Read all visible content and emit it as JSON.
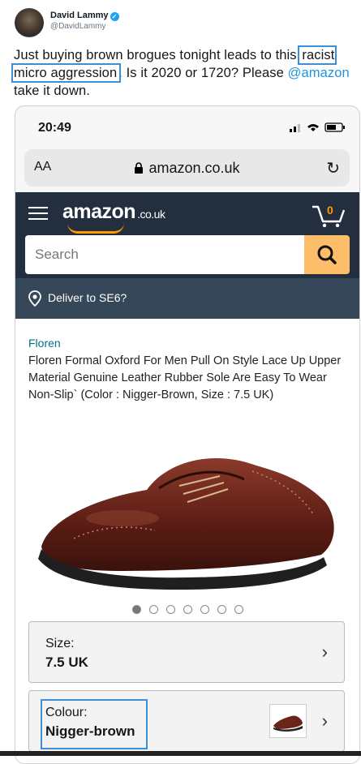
{
  "tweet": {
    "author_name": "David Lammy",
    "author_handle": "@DavidLammy",
    "text_part1": "Just buying brown brogues tonight leads to this",
    "text_highlight": "racist micro aggression",
    "text_part2": ". Is it 2020 or 1720? Please",
    "mention": "@amazon",
    "text_part3": " take it down."
  },
  "phone": {
    "time": "20:49",
    "text_size_label": "AA",
    "url": "amazon.co.uk",
    "search_placeholder": "Search",
    "logo_text": "amazon",
    "logo_suffix": ".co.uk",
    "cart_count": "0",
    "deliver_text": "Deliver to SE6?"
  },
  "product": {
    "brand": "Floren",
    "title": "Floren Formal Oxford For Men Pull On Style Lace Up Upper Material Genuine Leather Rubber Sole Are Easy To Wear Non-Slip` (Color : Nigger-Brown, Size : 7.5 UK)",
    "image_count": 7,
    "active_image_index": 1,
    "size_label": "Size:",
    "size_value": "7.5 UK",
    "colour_label": "Colour:",
    "colour_value": "Nigger-brown"
  },
  "colors": {
    "amazon_navy": "#232f3e",
    "amazon_orange": "#ff9900",
    "search_button": "#febd69",
    "highlight_box": "#3c8fd6",
    "twitter_link": "#1b95e0"
  }
}
